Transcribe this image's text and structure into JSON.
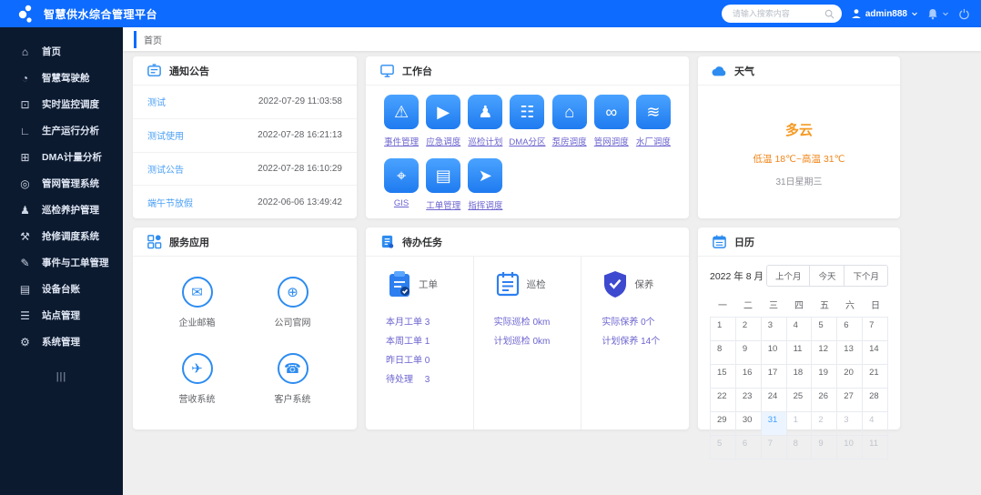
{
  "colors": {
    "header_blue": "#0d6bff",
    "sidebar_bg": "#0c1a30",
    "tile_blue": "#1f7bf0",
    "notice_link_blue": "#4a9ff5",
    "app_link_purple": "#6c64cf",
    "weather_orange": "#f59a23",
    "today_blue": "#409eff"
  },
  "header": {
    "title": "智慧供水综合管理平台",
    "search_placeholder": "请输入搜索内容",
    "username": "admin888"
  },
  "sidebar": {
    "items": [
      {
        "label": "首页",
        "icon": "home",
        "glyph": "⌂"
      },
      {
        "label": "智慧驾驶舱",
        "icon": "cockpit-gauge",
        "glyph": "◔"
      },
      {
        "label": "实时监控调度",
        "icon": "monitor",
        "glyph": "⊡"
      },
      {
        "label": "生产运行分析",
        "icon": "chart-axis",
        "glyph": "∟"
      },
      {
        "label": "DMA计量分析",
        "icon": "dma-network",
        "glyph": "⊞"
      },
      {
        "label": "管网管理系统",
        "icon": "pipe-network",
        "glyph": "◎"
      },
      {
        "label": "巡检养护管理",
        "icon": "patrol-person",
        "glyph": "♟"
      },
      {
        "label": "抢修调度系统",
        "icon": "repair-tools",
        "glyph": "⚒"
      },
      {
        "label": "事件与工单管理",
        "icon": "event-pencil",
        "glyph": "✎"
      },
      {
        "label": "设备台账",
        "icon": "ledger",
        "glyph": "▤"
      },
      {
        "label": "站点管理",
        "icon": "sliders",
        "glyph": "☰"
      },
      {
        "label": "系统管理",
        "icon": "gear",
        "glyph": "⚙"
      }
    ],
    "collapse_glyph": "|||"
  },
  "breadcrumb": {
    "label": "首页"
  },
  "cards": {
    "notice": {
      "title": "通知公告",
      "items": [
        {
          "title": "测试",
          "time": "2022-07-29 11:03:58"
        },
        {
          "title": "测试使用",
          "time": "2022-07-28 16:21:13"
        },
        {
          "title": "测试公告",
          "time": "2022-07-28 16:10:29"
        },
        {
          "title": "端午节放假",
          "time": "2022-06-06 13:49:42"
        }
      ]
    },
    "workbench": {
      "title": "工作台",
      "apps": [
        {
          "label": "事件管理",
          "icon": "alarm-beacon",
          "glyph": "⚠"
        },
        {
          "label": "应急调度",
          "icon": "emergency-screen",
          "glyph": "▶"
        },
        {
          "label": "巡检计划",
          "icon": "worker",
          "glyph": "♟"
        },
        {
          "label": "DMA分区",
          "icon": "partition-tree",
          "glyph": "☷"
        },
        {
          "label": "泵房调度",
          "icon": "pump-house",
          "glyph": "⌂"
        },
        {
          "label": "管网调度",
          "icon": "chain-links",
          "glyph": "∞"
        },
        {
          "label": "水厂调度",
          "icon": "water-plant",
          "glyph": "≋"
        },
        {
          "label": "GIS",
          "icon": "map-pin",
          "glyph": "⌖"
        },
        {
          "label": "工单管理",
          "icon": "work-order-board",
          "glyph": "▤"
        },
        {
          "label": "指挥调度",
          "icon": "route-dispatch",
          "glyph": "➤"
        }
      ]
    },
    "weather": {
      "title": "天气",
      "condition": "多云",
      "range": "低温 18℃~高温 31℃",
      "date": "31日星期三"
    },
    "services": {
      "title": "服务应用",
      "apps": [
        {
          "label": "企业邮箱",
          "icon": "mail",
          "glyph": "✉"
        },
        {
          "label": "公司官网",
          "icon": "globe-website",
          "glyph": "⊕"
        },
        {
          "label": "营收系统",
          "icon": "revenue-rocket",
          "glyph": "✈"
        },
        {
          "label": "客户系统",
          "icon": "customer-service",
          "glyph": "☎"
        }
      ]
    },
    "todo": {
      "title": "待办任务",
      "sections": [
        {
          "name": "工单",
          "icon": "work-order-clipboard",
          "items": [
            "本月工单 3",
            "本周工单 1",
            "昨日工单 0",
            "待处理　 3"
          ]
        },
        {
          "name": "巡检",
          "icon": "inspection-board",
          "items": [
            "实际巡检 0km",
            "计划巡检 0km"
          ]
        },
        {
          "name": "保养",
          "icon": "maintenance-shield",
          "items": [
            "实际保养 0个",
            "计划保养 14个"
          ]
        }
      ]
    },
    "calendar": {
      "title": "日历",
      "month_label": "2022 年 8 月",
      "buttons": [
        {
          "label": "上个月"
        },
        {
          "label": "今天"
        },
        {
          "label": "下个月"
        }
      ],
      "weekdays": [
        "一",
        "二",
        "三",
        "四",
        "五",
        "六",
        "日"
      ],
      "today": "31",
      "days": [
        {
          "d": "1"
        },
        {
          "d": "2"
        },
        {
          "d": "3"
        },
        {
          "d": "4"
        },
        {
          "d": "5"
        },
        {
          "d": "6"
        },
        {
          "d": "7"
        },
        {
          "d": "8"
        },
        {
          "d": "9"
        },
        {
          "d": "10"
        },
        {
          "d": "11"
        },
        {
          "d": "12"
        },
        {
          "d": "13"
        },
        {
          "d": "14"
        },
        {
          "d": "15"
        },
        {
          "d": "16"
        },
        {
          "d": "17"
        },
        {
          "d": "18"
        },
        {
          "d": "19"
        },
        {
          "d": "20"
        },
        {
          "d": "21"
        },
        {
          "d": "22"
        },
        {
          "d": "23"
        },
        {
          "d": "24"
        },
        {
          "d": "25"
        },
        {
          "d": "26"
        },
        {
          "d": "27"
        },
        {
          "d": "28"
        },
        {
          "d": "29"
        },
        {
          "d": "30"
        },
        {
          "d": "31"
        },
        {
          "d": "1"
        },
        {
          "d": "2"
        },
        {
          "d": "3"
        },
        {
          "d": "4"
        },
        {
          "d": "5"
        },
        {
          "d": "6"
        },
        {
          "d": "7"
        },
        {
          "d": "8"
        },
        {
          "d": "9"
        },
        {
          "d": "10"
        },
        {
          "d": "11"
        }
      ]
    }
  }
}
